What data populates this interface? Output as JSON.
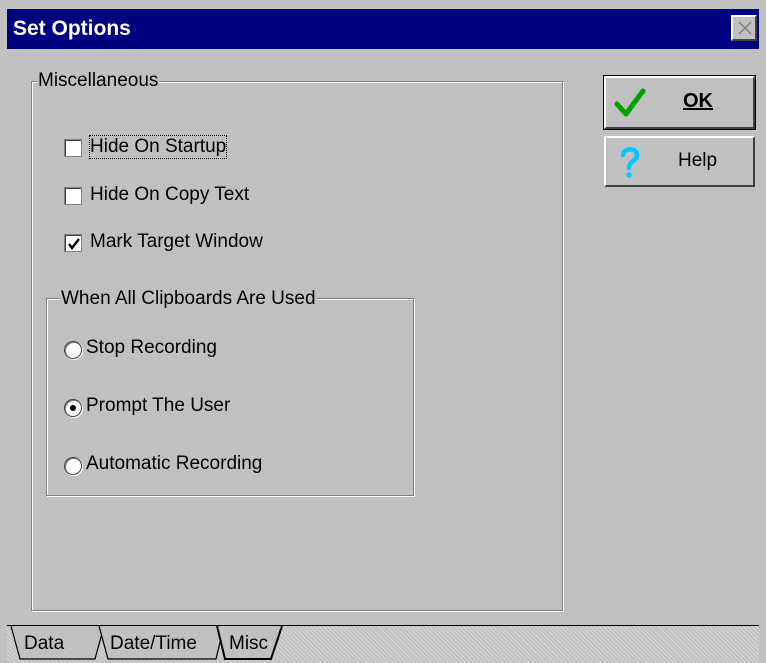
{
  "window": {
    "title": "Set Options"
  },
  "misc_group": {
    "label": "Miscellaneous",
    "checkboxes": [
      {
        "label": "Hide On Startup",
        "checked": false
      },
      {
        "label": "Hide On Copy Text",
        "checked": false
      },
      {
        "label": "Mark Target Window",
        "checked": true
      }
    ]
  },
  "clipboard_group": {
    "label": "When All Clipboards Are Used",
    "options": [
      {
        "label": "Stop Recording",
        "selected": false
      },
      {
        "label": "Prompt The User",
        "selected": true
      },
      {
        "label": "Automatic Recording",
        "selected": false
      }
    ]
  },
  "buttons": {
    "ok_label": "OK",
    "help_label": "Help"
  },
  "tabs": [
    {
      "label": "Data",
      "active": false
    },
    {
      "label": "Date/Time",
      "active": false
    },
    {
      "label": "Misc",
      "active": true
    }
  ],
  "icons": {
    "ok": "check-icon",
    "help": "question-mark-icon",
    "close": "close-icon"
  },
  "colors": {
    "titlebar": "#000080",
    "face": "#c0c0c0",
    "check_green": "#00a000",
    "help_cyan": "#00c8ff"
  }
}
